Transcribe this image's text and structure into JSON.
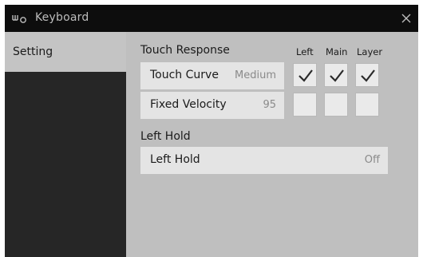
{
  "window": {
    "title": "Keyboard",
    "app_icon": "keyboard-hold-icon",
    "close_icon": "close-icon"
  },
  "sidebar": {
    "tabs": [
      {
        "label": "Setting"
      }
    ]
  },
  "touch_response": {
    "heading": "Touch Response",
    "columns": [
      "Left",
      "Main",
      "Layer"
    ],
    "rows": [
      {
        "label": "Touch Curve",
        "value": "Medium",
        "checks": [
          true,
          true,
          true
        ]
      },
      {
        "label": "Fixed Velocity",
        "value": "95",
        "checks": [
          false,
          false,
          false
        ]
      }
    ]
  },
  "left_hold": {
    "heading": "Left Hold",
    "label": "Left Hold",
    "value": "Off"
  },
  "colors": {
    "titlebar": "#0d0d0d",
    "panel": "#bfbfbf",
    "row": "#e4e4e4",
    "sidebar_dark": "#262626"
  }
}
